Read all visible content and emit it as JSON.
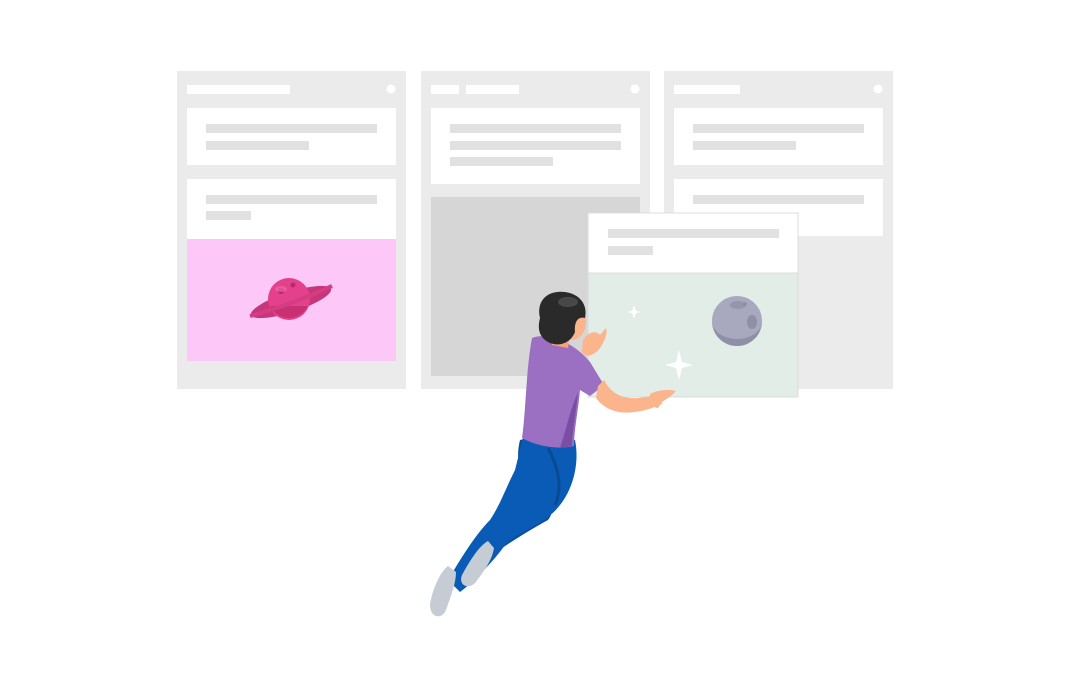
{
  "illustration": {
    "subject": "kanban-board-with-person-moving-card",
    "colors": {
      "background": "#ffffff",
      "list": "#ebebeb",
      "card": "#ffffff",
      "placeholder_bar": "#e1e1e1",
      "drop_zone": "#d6d6d6",
      "planet_cover": "#fdc8f7",
      "planet": "#e4418c",
      "moon_cover": "#e1ede6",
      "moon": "#a8a9bf",
      "shirt": "#9b6fc1",
      "pants": "#0a5bb5",
      "hair": "#2a2a2a",
      "skin": "#fbb48c"
    },
    "icons": [
      "planet-icon",
      "moon-icon",
      "sparkle-icon"
    ]
  }
}
